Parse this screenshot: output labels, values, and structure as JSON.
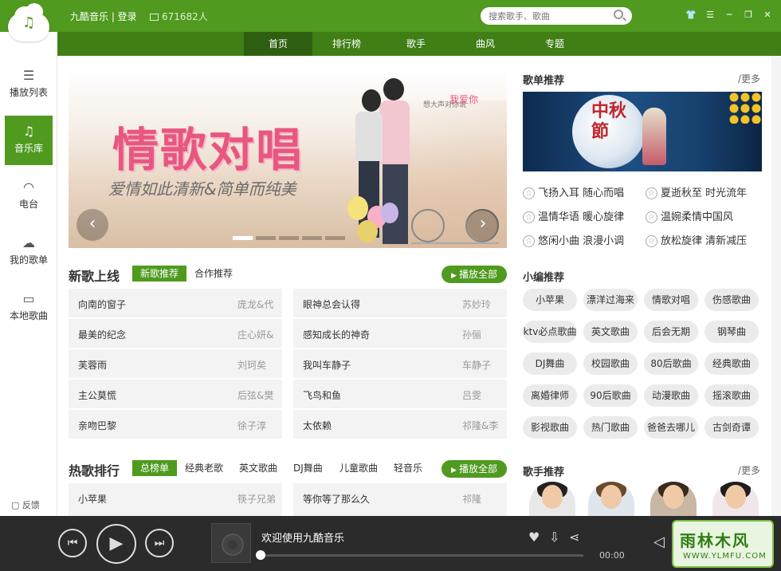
{
  "header": {
    "app_title": "九酷音乐 | 登录",
    "online_count": "671682人",
    "search_placeholder": "搜索歌手、歌曲"
  },
  "nav": {
    "items": [
      "首页",
      "排行榜",
      "歌手",
      "曲风",
      "专题"
    ],
    "active": "首页"
  },
  "sidebar": {
    "items": [
      {
        "label": "播放列表",
        "icon": "list-icon"
      },
      {
        "label": "音乐库",
        "icon": "music-note-icon"
      },
      {
        "label": "电台",
        "icon": "wifi-icon"
      },
      {
        "label": "我的歌单",
        "icon": "cloud-icon"
      },
      {
        "label": "本地歌曲",
        "icon": "monitor-icon"
      }
    ],
    "active": "音乐库",
    "feedback": "反馈"
  },
  "banner": {
    "headline": "情歌对唱",
    "subtitle": "爱情如此清新&简单而纯美",
    "note_small": "想大声对你说",
    "note_love": "我爱你",
    "slide_count": 5,
    "active_slide": 1
  },
  "new_songs": {
    "title": "新歌上线",
    "tabs": [
      "新歌推荐",
      "合作推荐"
    ],
    "play_all": "播放全部",
    "left": [
      {
        "name": "向南的窗子",
        "artist": "庞龙&代"
      },
      {
        "name": "最美的纪念",
        "artist": "庄心妍&"
      },
      {
        "name": "芙蓉雨",
        "artist": "刘珂矣"
      },
      {
        "name": "主公莫慌",
        "artist": "后弦&樊"
      },
      {
        "name": "亲吻巴黎",
        "artist": "徐子淳"
      }
    ],
    "right": [
      {
        "name": "眼神总会认得",
        "artist": "苏妙玲"
      },
      {
        "name": "感知成长的神奇",
        "artist": "孙俪"
      },
      {
        "name": "我叫车静子",
        "artist": "车静子"
      },
      {
        "name": "飞鸟和鱼",
        "artist": "吕雯"
      },
      {
        "name": "太依赖",
        "artist": "祁隆&李"
      }
    ]
  },
  "hot_songs": {
    "title": "热歌排行",
    "tabs": [
      "总榜单",
      "经典老歌",
      "英文歌曲",
      "DJ舞曲",
      "儿童歌曲",
      "轻音乐"
    ],
    "play_all": "播放全部",
    "left": [
      {
        "name": "小苹果",
        "artist": "筷子兄弟"
      }
    ],
    "right": [
      {
        "name": "等你等了那么久",
        "artist": "祁隆"
      }
    ]
  },
  "playlist_recs": {
    "title": "歌单推荐",
    "more": "/更多",
    "banner_text": "中秋節",
    "items": [
      "飞扬入耳 随心而唱",
      "夏逝秋至 时光流年",
      "温情华语 暖心旋律",
      "温婉柔情中国风",
      "悠闲小曲 浪漫小调",
      "放松旋律 清新减压"
    ]
  },
  "editor_recs": {
    "title": "小编推荐",
    "tags": [
      "小苹果",
      "漂洋过海来",
      "情歌对唱",
      "伤感歌曲",
      "ktv必点歌曲",
      "英文歌曲",
      "后会无期",
      "钢琴曲",
      "DJ舞曲",
      "校园歌曲",
      "80后歌曲",
      "经典歌曲",
      "离婚律师",
      "90后歌曲",
      "动漫歌曲",
      "摇滚歌曲",
      "影视歌曲",
      "热门歌曲",
      "爸爸去哪儿",
      "古剑奇谭"
    ]
  },
  "singer_recs": {
    "title": "歌手推荐",
    "more": "/更多"
  },
  "player": {
    "now_playing": "欢迎使用九酷音乐",
    "time": "00:00",
    "progress": 0
  },
  "watermark": {
    "line1": "雨林木风",
    "line2": "WWW.YLMFU.COM"
  },
  "colors": {
    "brand_green": "#4f9a1f",
    "nav_green": "#3f7f16",
    "player_bg": "#2b2b2b"
  }
}
